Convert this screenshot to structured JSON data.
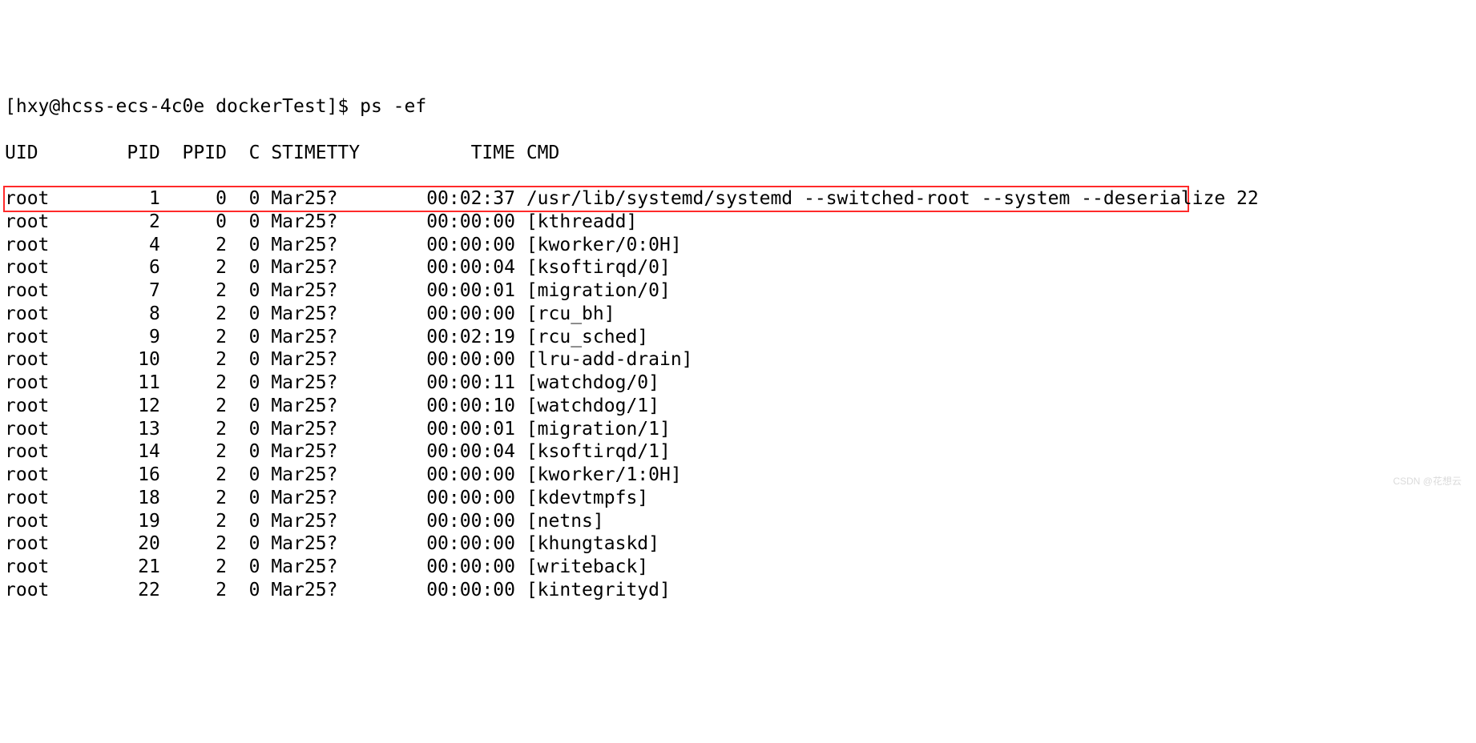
{
  "prompt": "[hxy@hcss-ecs-4c0e dockerTest]$ ps -ef",
  "header": {
    "uid": "UID",
    "pid": "PID",
    "ppid": "PPID",
    "c": "C",
    "stime": "STIME",
    "tty": "TTY",
    "time": "TIME",
    "cmd": "CMD"
  },
  "rows": [
    {
      "uid": "root",
      "pid": "1",
      "ppid": "0",
      "c": "0",
      "stime": "Mar25",
      "tty": "?",
      "time": "00:02:37",
      "cmd": "/usr/lib/systemd/systemd --switched-root --system --deserialize 22",
      "highlight": true
    },
    {
      "uid": "root",
      "pid": "2",
      "ppid": "0",
      "c": "0",
      "stime": "Mar25",
      "tty": "?",
      "time": "00:00:00",
      "cmd": "[kthreadd]"
    },
    {
      "uid": "root",
      "pid": "4",
      "ppid": "2",
      "c": "0",
      "stime": "Mar25",
      "tty": "?",
      "time": "00:00:00",
      "cmd": "[kworker/0:0H]"
    },
    {
      "uid": "root",
      "pid": "6",
      "ppid": "2",
      "c": "0",
      "stime": "Mar25",
      "tty": "?",
      "time": "00:00:04",
      "cmd": "[ksoftirqd/0]"
    },
    {
      "uid": "root",
      "pid": "7",
      "ppid": "2",
      "c": "0",
      "stime": "Mar25",
      "tty": "?",
      "time": "00:00:01",
      "cmd": "[migration/0]"
    },
    {
      "uid": "root",
      "pid": "8",
      "ppid": "2",
      "c": "0",
      "stime": "Mar25",
      "tty": "?",
      "time": "00:00:00",
      "cmd": "[rcu_bh]"
    },
    {
      "uid": "root",
      "pid": "9",
      "ppid": "2",
      "c": "0",
      "stime": "Mar25",
      "tty": "?",
      "time": "00:02:19",
      "cmd": "[rcu_sched]"
    },
    {
      "uid": "root",
      "pid": "10",
      "ppid": "2",
      "c": "0",
      "stime": "Mar25",
      "tty": "?",
      "time": "00:00:00",
      "cmd": "[lru-add-drain]"
    },
    {
      "uid": "root",
      "pid": "11",
      "ppid": "2",
      "c": "0",
      "stime": "Mar25",
      "tty": "?",
      "time": "00:00:11",
      "cmd": "[watchdog/0]"
    },
    {
      "uid": "root",
      "pid": "12",
      "ppid": "2",
      "c": "0",
      "stime": "Mar25",
      "tty": "?",
      "time": "00:00:10",
      "cmd": "[watchdog/1]"
    },
    {
      "uid": "root",
      "pid": "13",
      "ppid": "2",
      "c": "0",
      "stime": "Mar25",
      "tty": "?",
      "time": "00:00:01",
      "cmd": "[migration/1]"
    },
    {
      "uid": "root",
      "pid": "14",
      "ppid": "2",
      "c": "0",
      "stime": "Mar25",
      "tty": "?",
      "time": "00:00:04",
      "cmd": "[ksoftirqd/1]"
    },
    {
      "uid": "root",
      "pid": "16",
      "ppid": "2",
      "c": "0",
      "stime": "Mar25",
      "tty": "?",
      "time": "00:00:00",
      "cmd": "[kworker/1:0H]"
    },
    {
      "uid": "root",
      "pid": "18",
      "ppid": "2",
      "c": "0",
      "stime": "Mar25",
      "tty": "?",
      "time": "00:00:00",
      "cmd": "[kdevtmpfs]"
    },
    {
      "uid": "root",
      "pid": "19",
      "ppid": "2",
      "c": "0",
      "stime": "Mar25",
      "tty": "?",
      "time": "00:00:00",
      "cmd": "[netns]"
    },
    {
      "uid": "root",
      "pid": "20",
      "ppid": "2",
      "c": "0",
      "stime": "Mar25",
      "tty": "?",
      "time": "00:00:00",
      "cmd": "[khungtaskd]"
    },
    {
      "uid": "root",
      "pid": "21",
      "ppid": "2",
      "c": "0",
      "stime": "Mar25",
      "tty": "?",
      "time": "00:00:00",
      "cmd": "[writeback]"
    },
    {
      "uid": "root",
      "pid": "22",
      "ppid": "2",
      "c": "0",
      "stime": "Mar25",
      "tty": "?",
      "time": "00:00:00",
      "cmd": "[kintegrityd]"
    }
  ],
  "cols": {
    "uid": 8,
    "pid": 6,
    "ppid": 6,
    "c": 3,
    "stime": 6,
    "tty_width": 8,
    "time": 9
  },
  "watermark": "CSDN @花想云"
}
